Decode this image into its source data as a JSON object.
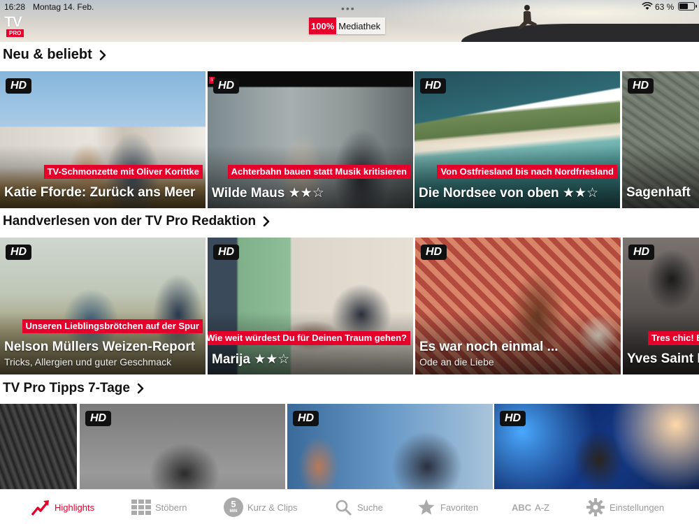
{
  "status_bar": {
    "time": "16:28",
    "date": "Montag 14. Feb.",
    "battery_percent": "63 %",
    "battery_level": 0.63
  },
  "header": {
    "logo_text": "TV",
    "logo_badge": "PRO",
    "mediathek_badge": "100%",
    "mediathek_label": "Mediathek"
  },
  "colors": {
    "brand_red": "#e4002b",
    "tab_inactive": "#999999"
  },
  "sections": [
    {
      "title": "Neu & beliebt",
      "cards": [
        {
          "badge": "HD",
          "ribbon": "TV-Schmonzette mit Oliver Korittke",
          "title": "Katie Fforde: Zurück ans Meer",
          "subtitle": ""
        },
        {
          "badge": "HD",
          "ribbon": "Achterbahn bauen statt Musik kritisieren",
          "title": "Wilde Maus ★★☆",
          "subtitle": ""
        },
        {
          "badge": "HD",
          "ribbon": "Von Ostfriesland bis nach Nordfriesland",
          "title": "Die Nordsee von oben ★★☆",
          "subtitle": ""
        },
        {
          "badge": "HD",
          "ribbon": "",
          "title": "Sagenhaft",
          "subtitle": ""
        }
      ]
    },
    {
      "title": "Handverlesen von der TV Pro Redaktion",
      "cards": [
        {
          "badge": "HD",
          "ribbon": "Unseren Lieblingsbrötchen auf der Spur",
          "title": "Nelson Müllers Weizen-Report",
          "subtitle": "Tricks, Allergien und guter Geschmack"
        },
        {
          "badge": "HD",
          "ribbon": "Wie weit würdest Du für Deinen Traum gehen?",
          "title": "Marija ★★☆",
          "subtitle": ""
        },
        {
          "badge": "HD",
          "ribbon": "",
          "title": "Es war noch einmal ...",
          "subtitle": "Ode an die Liebe"
        },
        {
          "badge": "HD",
          "ribbon": "Tres chic! Ein",
          "title": "Yves Saint L",
          "subtitle": ""
        }
      ]
    },
    {
      "title": "TV Pro Tipps 7-Tage",
      "cards": [
        {
          "badge": "",
          "ribbon": "",
          "title": "",
          "subtitle": ""
        },
        {
          "badge": "HD",
          "ribbon": "",
          "title": "",
          "subtitle": ""
        },
        {
          "badge": "HD",
          "ribbon": "",
          "title": "",
          "subtitle": ""
        },
        {
          "badge": "HD",
          "ribbon": "",
          "title": "",
          "subtitle": ""
        }
      ]
    }
  ],
  "tabbar": {
    "tabs": [
      {
        "label": "Highlights",
        "icon": "trend-arrow-icon",
        "active": true
      },
      {
        "label": "Stöbern",
        "icon": "grid-icon",
        "active": false
      },
      {
        "label": "Kurz & Clips",
        "icon": "five-min-icon",
        "icon_text": "5",
        "icon_subtext": "MIN",
        "active": false
      },
      {
        "label": "Suche",
        "icon": "search-icon",
        "active": false
      },
      {
        "label": "Favoriten",
        "icon": "star-icon",
        "active": false
      },
      {
        "label": "A-Z",
        "icon": "abc-icon",
        "icon_text": "ABC",
        "active": false
      },
      {
        "label": "Einstellungen",
        "icon": "gear-icon",
        "active": false
      }
    ]
  }
}
